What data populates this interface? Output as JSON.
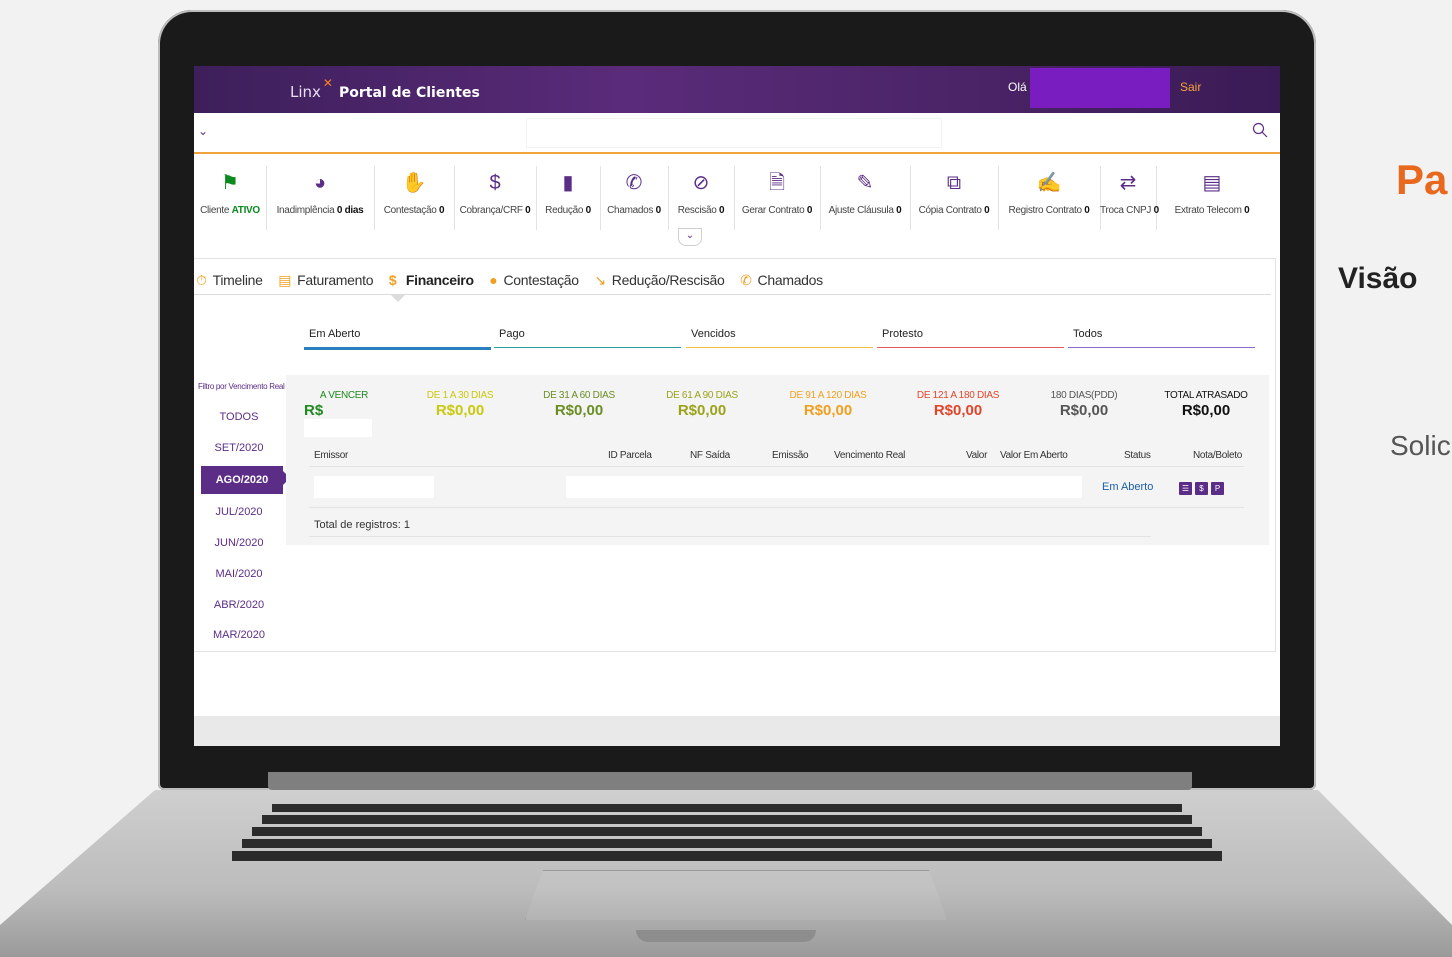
{
  "brand": {
    "logo_text": "Linx",
    "title": "Portal de Clientes"
  },
  "header": {
    "greeting": "Olá",
    "logout": "Sair"
  },
  "toolbar": [
    {
      "icon": "flag-icon",
      "label": "Cliente",
      "value": "ATIVO"
    },
    {
      "icon": "gauge-icon",
      "label": "Inadimplência",
      "value": "0 dias"
    },
    {
      "icon": "hand-icon",
      "label": "Contestação",
      "value": "0"
    },
    {
      "icon": "dollar-icon",
      "label": "Cobrança/CRF",
      "value": "0"
    },
    {
      "icon": "alert-doc-icon",
      "label": "Redução",
      "value": "0"
    },
    {
      "icon": "phone-icon",
      "label": "Chamados",
      "value": "0"
    },
    {
      "icon": "cancel-dollar-icon",
      "label": "Rescisão",
      "value": "0"
    },
    {
      "icon": "document-icon",
      "label": "Gerar Contrato",
      "value": "0"
    },
    {
      "icon": "edit-icon",
      "label": "Ajuste Cláusula",
      "value": "0"
    },
    {
      "icon": "copy-icon",
      "label": "Cópia Contrato",
      "value": "0"
    },
    {
      "icon": "sign-icon",
      "label": "Registro Contrato",
      "value": "0"
    },
    {
      "icon": "swap-icon",
      "label": "Troca CNPJ",
      "value": "0"
    },
    {
      "icon": "chart-icon",
      "label": "Extrato Telecom",
      "value": "0"
    }
  ],
  "nav_tabs": [
    "Timeline",
    "Faturamento",
    "Financeiro",
    "Contestação",
    "Redução/Rescisão",
    "Chamados"
  ],
  "sub_tabs": [
    "Em Aberto",
    "Pago",
    "Vencidos",
    "Protesto",
    "Todos"
  ],
  "filter": {
    "title": "Filtro por Vencimento Real",
    "months": [
      "TODOS",
      "SET/2020",
      "AGO/2020",
      "JUL/2020",
      "JUN/2020",
      "MAI/2020",
      "ABR/2020",
      "MAR/2020"
    ],
    "selected": "AGO/2020"
  },
  "summary": [
    {
      "label": "A VENCER",
      "value": "R$",
      "color": "#1f8a1f"
    },
    {
      "label": "DE 1 A 30 DIAS",
      "value": "R$0,00",
      "color": "#c9c90e"
    },
    {
      "label": "DE 31 A 60 DIAS",
      "value": "R$0,00",
      "color": "#6b8e23"
    },
    {
      "label": "DE 61 A 90 DIAS",
      "value": "R$0,00",
      "color": "#9aa31a"
    },
    {
      "label": "DE 91 A 120 DIAS",
      "value": "R$0,00",
      "color": "#f0a020"
    },
    {
      "label": "DE 121 A 180 DIAS",
      "value": "R$0,00",
      "color": "#e0462a"
    },
    {
      "label": "180 DIAS(PDD)",
      "value": "R$0,00",
      "color": "#555555"
    },
    {
      "label": "TOTAL ATRASADO",
      "value": "R$0,00",
      "color": "#111111"
    }
  ],
  "table": {
    "headers": [
      "Emissor",
      "ID Parcela",
      "NF Saída",
      "Emissão",
      "Vencimento Real",
      "Valor",
      "Valor Em Aberto",
      "Status",
      "Nota/Boleto"
    ],
    "row_status": "Em Aberto",
    "total": "Total de registros: 1"
  },
  "right_text": {
    "line1": "Pa",
    "line2": "Visão",
    "line3": "Solic"
  }
}
